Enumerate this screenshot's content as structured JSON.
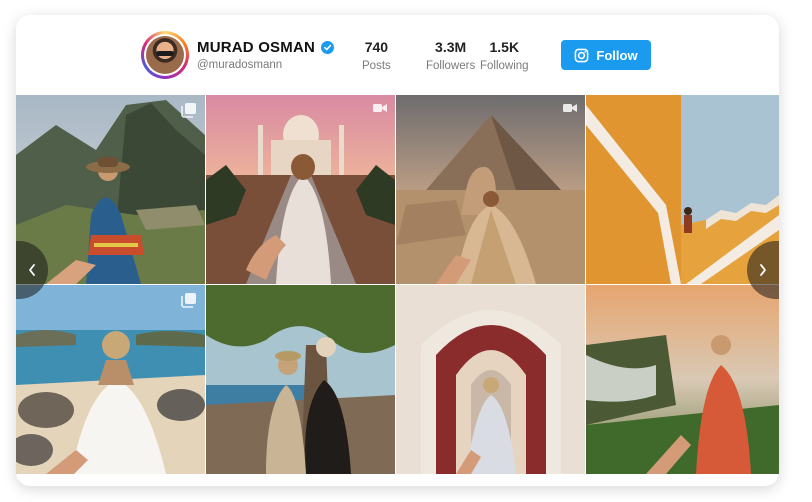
{
  "profile": {
    "name": "MURAD OSMAN",
    "handle": "@muradosmann"
  },
  "stats": [
    {
      "value": "740",
      "label": "Posts"
    },
    {
      "value": "3.3M",
      "label": "Followers"
    },
    {
      "value": "1.5K",
      "label": "Following"
    }
  ],
  "follow_button": {
    "label": "Follow"
  },
  "colors": {
    "accent": "#1a9bf0"
  },
  "photos": [
    {
      "subject": "machu-picchu",
      "overlay_icon": "carousel-icon"
    },
    {
      "subject": "taj-mahal",
      "overlay_icon": "video-icon"
    },
    {
      "subject": "pyramid-giza",
      "overlay_icon": "video-icon"
    },
    {
      "subject": "yellow-wall-stairs",
      "overlay_icon": ""
    },
    {
      "subject": "beach-tortoises",
      "overlay_icon": "carousel-icon"
    },
    {
      "subject": "tree-beach-child",
      "overlay_icon": ""
    },
    {
      "subject": "moroccan-arch",
      "overlay_icon": ""
    },
    {
      "subject": "waterfall",
      "overlay_icon": ""
    }
  ]
}
